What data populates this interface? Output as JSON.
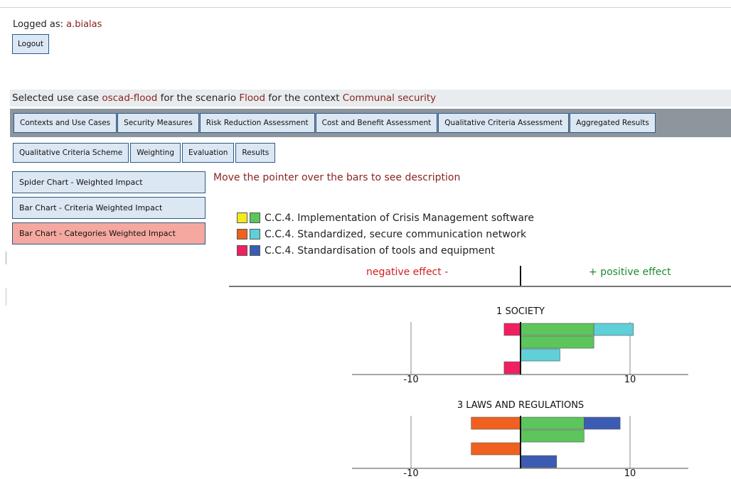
{
  "login": {
    "prefix": "Logged as: ",
    "user": "a.bialas",
    "logout_label": "Logout"
  },
  "context": {
    "t1": "Selected use case ",
    "use_case": "oscad-flood",
    "t2": " for the scenario ",
    "scenario": "Flood",
    "t3": " for the context ",
    "ctx": "Communal security"
  },
  "main_tabs": [
    "Contexts and Use Cases",
    "Security Measures",
    "Risk Reduction Assessment",
    "Cost and Benefit Assessment",
    "Qualitative Criteria Assessment",
    "Aggregated Results"
  ],
  "sub_tabs": [
    "Qualitative Criteria Scheme",
    "Weighting",
    "Evaluation",
    "Results"
  ],
  "side_buttons": [
    "Spider Chart - Weighted Impact",
    "Bar Chart - Criteria Weighted Impact",
    "Bar Chart - Categories Weighted Impact"
  ],
  "hint": "Move the pointer over the bars to see description",
  "legend": [
    {
      "label": "C.C.4. Implementation of Crisis Management software",
      "neg_color": "#f2ea1b",
      "pos_color": "#5cc55c"
    },
    {
      "label": "C.C.4. Standardized, secure communication network",
      "neg_color": "#f0601e",
      "pos_color": "#5fcfd8"
    },
    {
      "label": "C.C.4. Standardisation of tools and equipment",
      "neg_color": "#ef1f60",
      "pos_color": "#3c5cb3"
    }
  ],
  "effects": {
    "negative": "negative effect -",
    "positive": "+ positive effect"
  },
  "colors": {
    "button_bg": "#dce7f4",
    "button_border": "#2a5a8a",
    "active_button_bg": "#f5a8a0",
    "tab_bar_bg": "#8d959d",
    "context_red": "#8b2323"
  },
  "chart_data": [
    {
      "type": "bar",
      "orientation": "horizontal-diverging",
      "title": "1 SOCIETY",
      "xlim": [
        -10,
        10
      ],
      "ticks": [
        "-10",
        "10"
      ],
      "rows": [
        [
          {
            "value": -1.5,
            "color": "#ef1f60"
          },
          {
            "value": 6.7,
            "color": "#5cc55c"
          },
          {
            "value": 3.6,
            "color": "#5fcfd8"
          }
        ],
        [
          {
            "value": 6.7,
            "color": "#5cc55c"
          }
        ],
        [
          {
            "value": 3.6,
            "color": "#5fcfd8"
          }
        ],
        [
          {
            "value": -1.5,
            "color": "#ef1f60"
          }
        ]
      ]
    },
    {
      "type": "bar",
      "orientation": "horizontal-diverging",
      "title": "3 LAWS AND REGULATIONS",
      "xlim": [
        -10,
        10
      ],
      "ticks": [
        "-10",
        "10"
      ],
      "rows": [
        [
          {
            "value": -4.5,
            "color": "#f0601e"
          },
          {
            "value": 5.8,
            "color": "#5cc55c"
          },
          {
            "value": 3.3,
            "color": "#3c5cb3"
          }
        ],
        [
          {
            "value": 5.8,
            "color": "#5cc55c"
          }
        ],
        [
          {
            "value": -4.5,
            "color": "#f0601e"
          }
        ],
        [
          {
            "value": 3.3,
            "color": "#3c5cb3"
          }
        ]
      ]
    }
  ]
}
